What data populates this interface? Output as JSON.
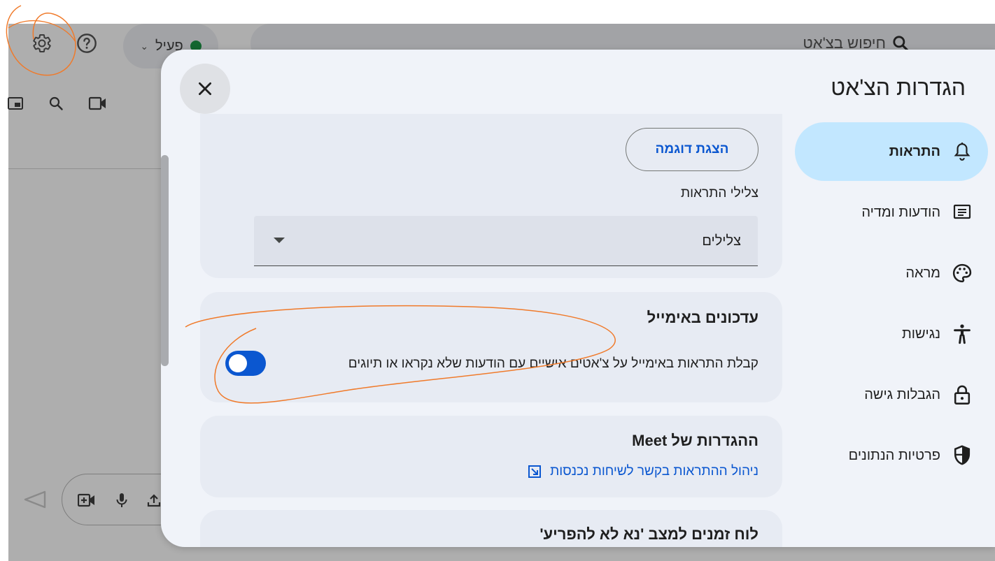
{
  "background": {
    "status_label": "פעיל",
    "search_placeholder": "חיפוש בצ'אט"
  },
  "dialog": {
    "title": "הגדרות הצ'אט",
    "close_label": "close"
  },
  "nav": {
    "items": [
      {
        "label": "התראות",
        "icon": "bell-icon",
        "active": true
      },
      {
        "label": "הודעות ומדיה",
        "icon": "message-icon",
        "active": false
      },
      {
        "label": "מראה",
        "icon": "palette-icon",
        "active": false
      },
      {
        "label": "נגישות",
        "icon": "accessibility-icon",
        "active": false
      },
      {
        "label": "הגבלות גישה",
        "icon": "lock-icon",
        "active": false
      },
      {
        "label": "פרטיות הנתונים",
        "icon": "shield-icon",
        "active": false
      }
    ]
  },
  "notifications": {
    "demo_button": "הצגת דוגמה",
    "sounds_label": "צלילי התראות",
    "sounds_value": "צלילים"
  },
  "email_updates": {
    "heading": "עדכונים באימייל",
    "description": "קבלת התראות באימייל על צ'אטים אישיים עם הודעות שלא נקראו או תיוגים",
    "enabled": true
  },
  "meet": {
    "heading": "ההגדרות של Meet",
    "link": "ניהול ההתראות בקשר לשיחות נכנסות"
  },
  "dnd": {
    "heading": "לוח זמנים למצב 'נא לא להפריע'"
  },
  "colors": {
    "accent": "#0b57d0",
    "active_nav": "#c2e7ff",
    "annotation": "#f07a2a"
  }
}
